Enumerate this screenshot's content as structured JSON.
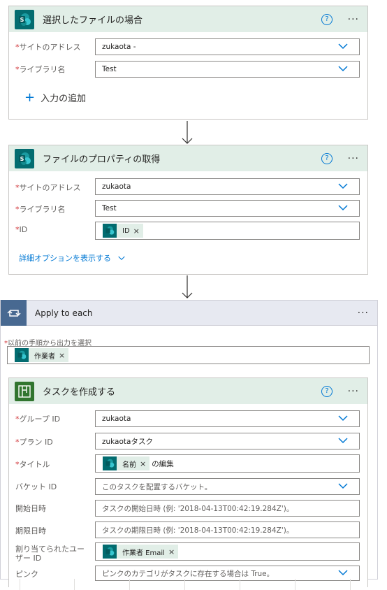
{
  "card1": {
    "title": "選択したファイルの場合",
    "fields": [
      {
        "label": "サイトのアドレス",
        "value": "zukaota -"
      },
      {
        "label": "ライブラリ名",
        "value": "Test"
      }
    ],
    "add_input": "入力の追加"
  },
  "card2": {
    "title": "ファイルのプロパティの取得",
    "fields": [
      {
        "label": "サイトのアドレス",
        "value": "zukaota"
      },
      {
        "label": "ライブラリ名",
        "value": "Test"
      },
      {
        "label": "ID",
        "token": "ID"
      }
    ],
    "advanced": "詳細オプションを表示する"
  },
  "loop": {
    "title": "Apply to each",
    "select_label": "以前の手順から出力を選択",
    "token": "作業者"
  },
  "card3": {
    "title": "タスクを作成する",
    "fields": [
      {
        "label": "グループ ID",
        "value": "zukaota"
      },
      {
        "label": "プラン ID",
        "value": "zukaotaタスク"
      },
      {
        "label": "タイトル",
        "token": "名前",
        "suffix": "の編集"
      },
      {
        "label": "バケット ID",
        "placeholder": "このタスクを配置するバケット。"
      },
      {
        "label": "開始日時",
        "placeholder": "タスクの開始日時 (例: '2018-04-13T00:42:19.284Z')。"
      },
      {
        "label": "期限日時",
        "placeholder": "タスクの期限日時 (例: '2018-04-13T00:42:19.284Z')。"
      },
      {
        "label": "割り当てられたユーザー ID",
        "token": "作業者 Email"
      },
      {
        "label": "ピンク",
        "placeholder": "ピンクのカテゴリがタスクに存在する場合は True。"
      }
    ]
  },
  "common": {
    "required_mark": "*",
    "help_glyph": "?",
    "more_glyph": "···",
    "token_remove": "×",
    "plus_glyph": "+",
    "chevron_glyph": "∨"
  },
  "colors": {
    "sharepoint": "#036c70",
    "planner": "#31752f",
    "loop": "#486991",
    "accent": "#0078d4",
    "required": "#d13438",
    "card_header": "#e1eee7",
    "loop_header": "#e7e9f1"
  },
  "icons": {
    "sharepoint": "sharepoint-icon",
    "planner": "planner-icon",
    "loop": "loop-icon",
    "help": "help-icon",
    "more": "more-icon",
    "chevron": "chevron-down-icon",
    "arrow": "arrow-down-icon",
    "plus": "plus-icon"
  }
}
